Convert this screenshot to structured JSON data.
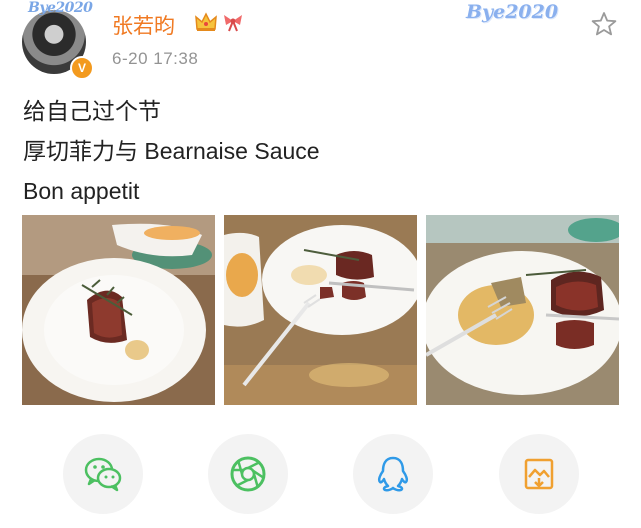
{
  "post": {
    "author": {
      "name": "张若昀",
      "avatar_icon": "avatar",
      "verified_badge": "V",
      "frame_text": "Bye2020"
    },
    "timestamp": "6-20 17:38",
    "card_decor_text": "Bye2020",
    "content_lines": [
      "给自己过个节",
      "厚切菲力与 Bearnaise Sauce",
      "Bon appetit"
    ],
    "images": [
      {
        "icon": "steak-photo-1"
      },
      {
        "icon": "steak-photo-2"
      },
      {
        "icon": "steak-photo-3"
      }
    ]
  },
  "share_buttons": [
    {
      "icon": "wechat-icon",
      "color": "#4cc061"
    },
    {
      "icon": "moments-icon",
      "color": "#4cc061"
    },
    {
      "icon": "qq-icon",
      "color": "#2f9ae8"
    },
    {
      "icon": "save-image-icon",
      "color": "#f0a030"
    }
  ],
  "colors": {
    "username": "#f07a23",
    "timestamp": "#939393",
    "verified": "#f39a1e"
  }
}
